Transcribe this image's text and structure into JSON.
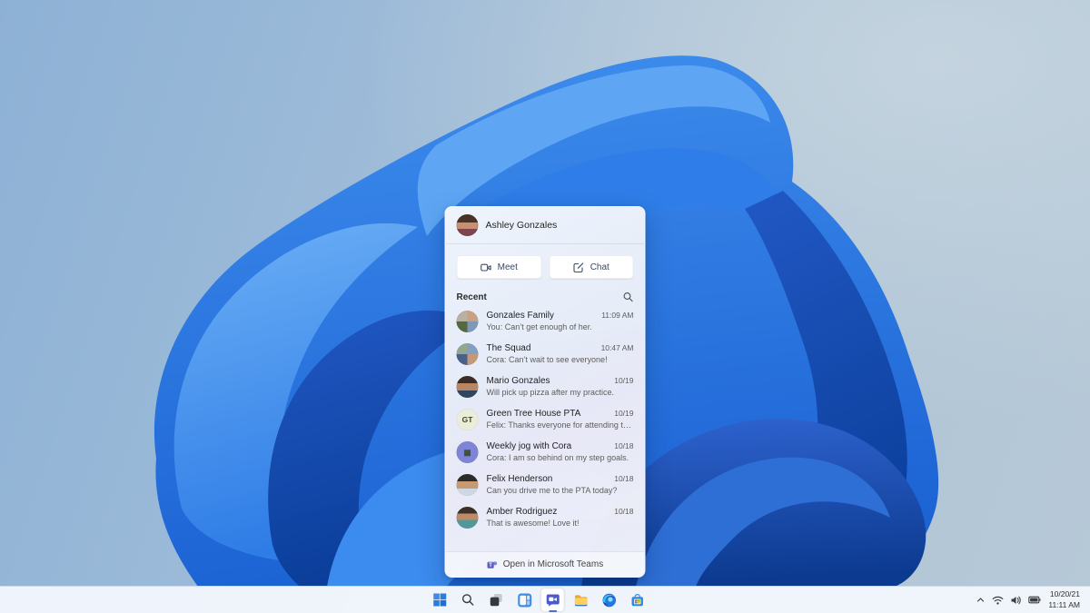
{
  "flyout": {
    "user": {
      "name": "Ashley Gonzales",
      "avatar": "ashley-avatar"
    },
    "buttons": {
      "meet": "Meet",
      "chat": "Chat"
    },
    "recent_label": "Recent",
    "conversations": [
      {
        "name": "Gonzales Family",
        "preview": "You: Can’t get enough of her.",
        "time": "11:09 AM",
        "avatar": "family"
      },
      {
        "name": "The Squad",
        "preview": "Cora: Can’t wait to see everyone!",
        "time": "10:47 AM",
        "avatar": "squad"
      },
      {
        "name": "Mario Gonzales",
        "preview": "Will pick up pizza after my practice.",
        "time": "10/19",
        "avatar": "mario"
      },
      {
        "name": "Green Tree House PTA",
        "preview": "Felix: Thanks everyone for attending today.",
        "time": "10/19",
        "avatar": "initials",
        "initials": "GT"
      },
      {
        "name": "Weekly jog with Cora",
        "preview": "Cora: I am so behind on my step goals.",
        "time": "10/18",
        "avatar": "calendar",
        "glyph": "▦"
      },
      {
        "name": "Felix Henderson",
        "preview": "Can you drive me to the PTA today?",
        "time": "10/18",
        "avatar": "felix"
      },
      {
        "name": "Amber Rodriguez",
        "preview": "That is awesome! Love it!",
        "time": "10/18",
        "avatar": "amber"
      }
    ],
    "footer": {
      "label": "Open in Microsoft Teams"
    }
  },
  "taskbar": {
    "items": [
      "start",
      "search",
      "task-view",
      "widgets",
      "chat",
      "file-explorer",
      "edge",
      "store"
    ],
    "active_item": "chat",
    "tray": {
      "icons": [
        "chevron-up",
        "wifi",
        "speaker",
        "battery"
      ],
      "date": "10/20/21",
      "time": "11:11 AM"
    }
  },
  "colors": {
    "bloom_blue": "#2e7ce6",
    "bloom_deep": "#0b3e9a",
    "accent": "#4a70c8",
    "teams_purple": "#5b5fc7",
    "taskbar_bg": "#f2f6fc"
  }
}
